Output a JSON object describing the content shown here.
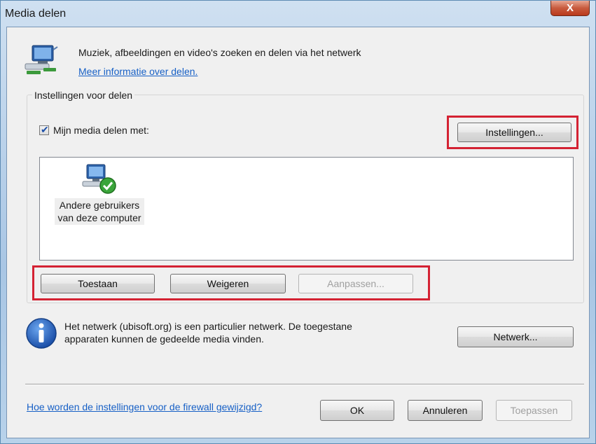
{
  "window": {
    "title": "Media delen",
    "close_label": "X"
  },
  "header": {
    "text": "Muziek, afbeeldingen en video's zoeken en delen via het netwerk",
    "link": "Meer informatie over delen.",
    "icon": "network-media-icon"
  },
  "sharing": {
    "group_label": "Instellingen voor delen",
    "checkbox_label": "Mijn media delen met:",
    "checkbox_checked": true,
    "settings_button": "Instellingen...",
    "devices": [
      {
        "label_line1": "Andere gebruikers",
        "label_line2": "van deze computer",
        "icon": "allowed-users-icon"
      }
    ],
    "allow_button": "Toestaan",
    "deny_button": "Weigeren",
    "customize_button": "Aanpassen..."
  },
  "network": {
    "info_line1": "Het netwerk (ubisoft.org) is een particulier netwerk. De toegestane",
    "info_line2": "apparaten kunnen de gedeelde media vinden.",
    "network_button": "Netwerk...",
    "icon": "info-icon"
  },
  "footer": {
    "firewall_link": "Hoe worden de instellingen voor de firewall gewijzigd?",
    "ok_button": "OK",
    "cancel_button": "Annuleren",
    "apply_button": "Toepassen"
  },
  "colors": {
    "highlight": "#d42233",
    "link": "#1760c6"
  }
}
